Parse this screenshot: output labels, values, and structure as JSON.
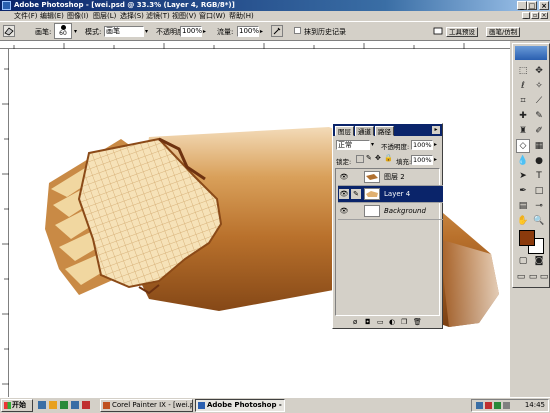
{
  "window": {
    "title": "Adobe Photoshop - [wei.psd @ 33.3% (Layer 4, RGB/8*)]"
  },
  "menu": {
    "items": [
      "文件(F)",
      "编辑(E)",
      "图像(I)",
      "图层(L)",
      "选择(S)",
      "滤镜(T)",
      "视图(V)",
      "窗口(W)",
      "帮助(H)"
    ]
  },
  "options": {
    "brush_label": "画笔:",
    "brush_size": "60",
    "mode_label": "模式:",
    "mode_value": "画笔",
    "opacity_label": "不透明度:",
    "opacity_value": "100%",
    "flow_label": "流量:",
    "flow_value": "100%",
    "history_checkbox_label": "抹到历史记录",
    "tab_buttons": [
      "工具预设",
      "画笔/仿制"
    ]
  },
  "layers_panel": {
    "tabs": [
      "图层",
      "通道",
      "路径"
    ],
    "blend_mode": "正常",
    "opacity_label": "不透明度:",
    "opacity_value": "100%",
    "lock_label": "锁定:",
    "fill_label": "填充:",
    "fill_value": "100%",
    "layers": [
      {
        "name": "图层 2",
        "visible": true,
        "selected": false
      },
      {
        "name": "Layer 4",
        "visible": true,
        "selected": true
      },
      {
        "name": "Background",
        "visible": true,
        "selected": false
      }
    ]
  },
  "taskbar": {
    "start_label": "开始",
    "tasks": [
      {
        "label": "Corel Painter IX - [wei.ps...",
        "active": false
      },
      {
        "label": "Adobe Photoshop - [w...",
        "active": true
      }
    ],
    "clock": "14:45"
  },
  "colors": {
    "title_bar": "#0a246a",
    "foreground_color": "#8b3a0c",
    "background_color": "#ffffff",
    "selected_layer": "#0a246a"
  }
}
